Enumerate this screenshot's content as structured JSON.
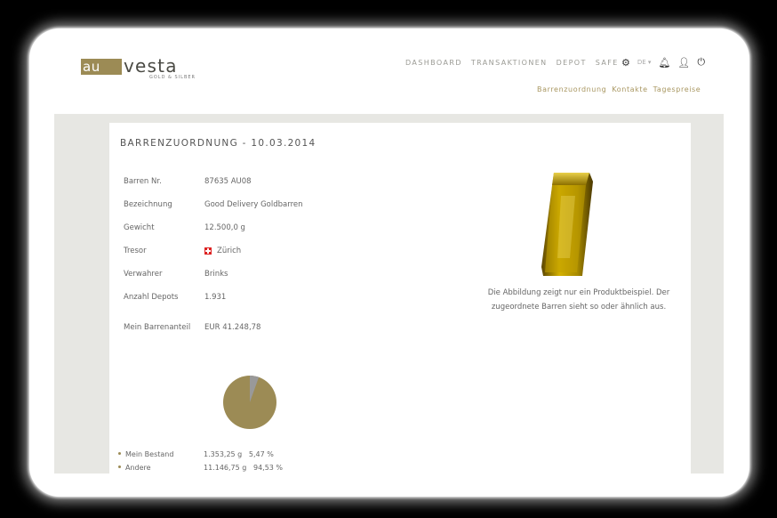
{
  "logo": {
    "box_text": "au",
    "rest_text": "vesta",
    "tagline": "GOLD & SILBER"
  },
  "nav": {
    "items": [
      "DASHBOARD",
      "TRANSAKTIONEN",
      "DEPOT",
      "SAFE"
    ],
    "language": "DE",
    "icons": [
      "gear-icon",
      "bell-icon",
      "user-icon",
      "power-icon"
    ]
  },
  "subnav": [
    "Barrenzuordnung",
    "Kontakte",
    "Tagespreise"
  ],
  "card": {
    "title": "BARRENZUORDNUNG - 10.03.2014",
    "fields": [
      {
        "label": "Barren Nr.",
        "value": "87635 AU08"
      },
      {
        "label": "Bezeichnung",
        "value": "Good Delivery Goldbarren"
      },
      {
        "label": "Gewicht",
        "value": "12.500,0 g"
      },
      {
        "label": "Tresor",
        "value": "Zürich",
        "flag": "swiss-flag"
      },
      {
        "label": "Verwahrer",
        "value": "Brinks"
      },
      {
        "label": "Anzahl Depots",
        "value": "1.931"
      },
      {
        "label": "Mein Barrenanteil",
        "value": "EUR 41.248,78"
      }
    ],
    "caption_line1": "Die Abbildung zeigt nur ein Produktbeispiel. Der",
    "caption_line2": "zugeordnete Barren sieht so oder ähnlich aus."
  },
  "chart_data": {
    "type": "pie",
    "series": [
      {
        "name": "Mein Bestand",
        "value_label": "1.353,25 g",
        "percent": 5.47
      },
      {
        "name": "Andere",
        "value_label": "11.146,75 g",
        "percent": 94.53
      }
    ],
    "percent_labels": [
      "5,47 %",
      "94,53 %"
    ]
  },
  "colors": {
    "accent": "#9c8b55",
    "other": "#999999",
    "nav": "#9a9a94"
  }
}
